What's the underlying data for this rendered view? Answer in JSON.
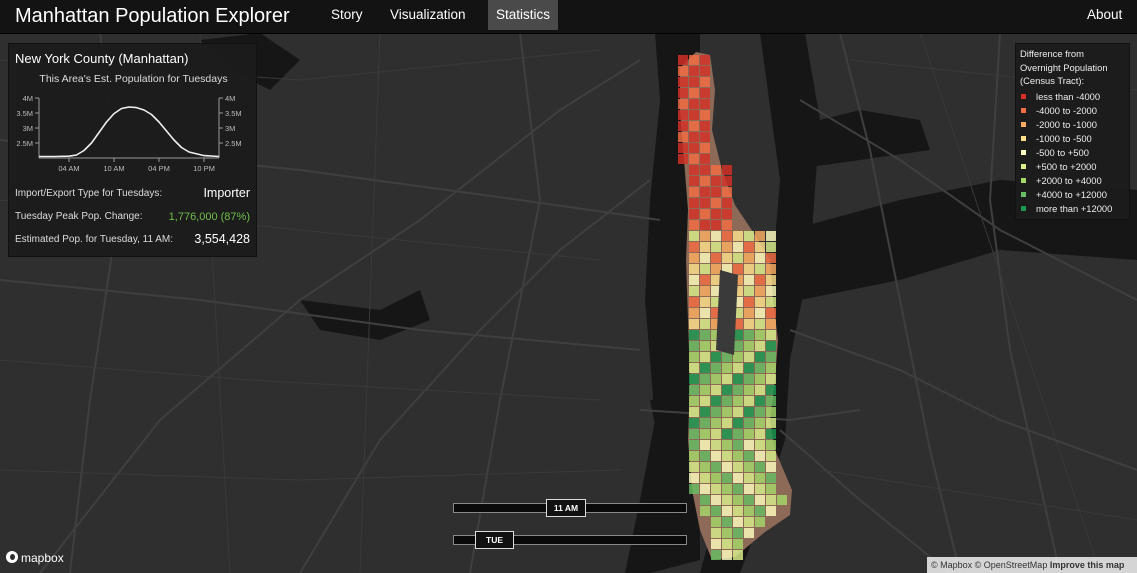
{
  "navbar": {
    "brand": "Manhattan Population Explorer",
    "items": [
      {
        "label": "Story",
        "active": false
      },
      {
        "label": "Visualization",
        "active": false
      },
      {
        "label": "Statistics",
        "active": true
      }
    ],
    "about": "About"
  },
  "stats": {
    "title": "New York County (Manhattan)",
    "chart_title": "This Area's Est. Population for Tuesdays",
    "rows": [
      {
        "label": "Import/Export Type for Tuesdays:",
        "value": "Importer"
      },
      {
        "label": "Tuesday Peak Pop. Change:",
        "value": "1,776,000 (87%)"
      },
      {
        "label": "Estimated Pop. for Tuesday, 11 AM:",
        "value": "3,554,428"
      }
    ],
    "colors": {
      "positive": "#6fbf4a"
    }
  },
  "chart_data": {
    "type": "line",
    "title": "This Area's Est. Population for Tuesdays",
    "x_ticks": [
      "04 AM",
      "10 AM",
      "04 PM",
      "10 PM"
    ],
    "y_ticks": [
      "4M",
      "3.5M",
      "3M",
      "2.5M"
    ],
    "ylim": [
      2000000,
      4000000
    ],
    "series": [
      {
        "x": [
          0,
          2,
          4,
          5,
          6,
          7,
          8,
          9,
          10,
          11,
          12,
          13,
          14,
          15,
          16,
          17,
          18,
          19,
          20,
          22,
          24
        ],
        "values": [
          2050000,
          2050000,
          2060000,
          2100000,
          2250000,
          2500000,
          2850000,
          3200000,
          3480000,
          3650000,
          3700000,
          3680000,
          3600000,
          3450000,
          3200000,
          2900000,
          2600000,
          2350000,
          2200000,
          2080000,
          2050000
        ]
      }
    ]
  },
  "legend": {
    "title_lines": [
      "Difference from",
      "Overnight Population",
      "(Census Tract):"
    ],
    "items": [
      {
        "label": "less than -4000",
        "color": "#d73027"
      },
      {
        "label": "-4000 to -2000",
        "color": "#f46d43"
      },
      {
        "label": "-2000 to -1000",
        "color": "#fdae61"
      },
      {
        "label": "-1000 to -500",
        "color": "#fee08b"
      },
      {
        "label": "-500 to +500",
        "color": "#ffffbf"
      },
      {
        "label": "+500 to +2000",
        "color": "#d9ef8b"
      },
      {
        "label": "+2000 to +4000",
        "color": "#a6d96a"
      },
      {
        "label": "+4000 to +12000",
        "color": "#66bd63"
      },
      {
        "label": "more than +12000",
        "color": "#1a9850"
      }
    ]
  },
  "time_slider": {
    "label": "11 AM"
  },
  "day_slider": {
    "label": "TUE"
  },
  "map": {
    "logo_text": "mapbox",
    "attribution": "© Mapbox © OpenStreetMap",
    "improve_link": "Improve this map"
  }
}
